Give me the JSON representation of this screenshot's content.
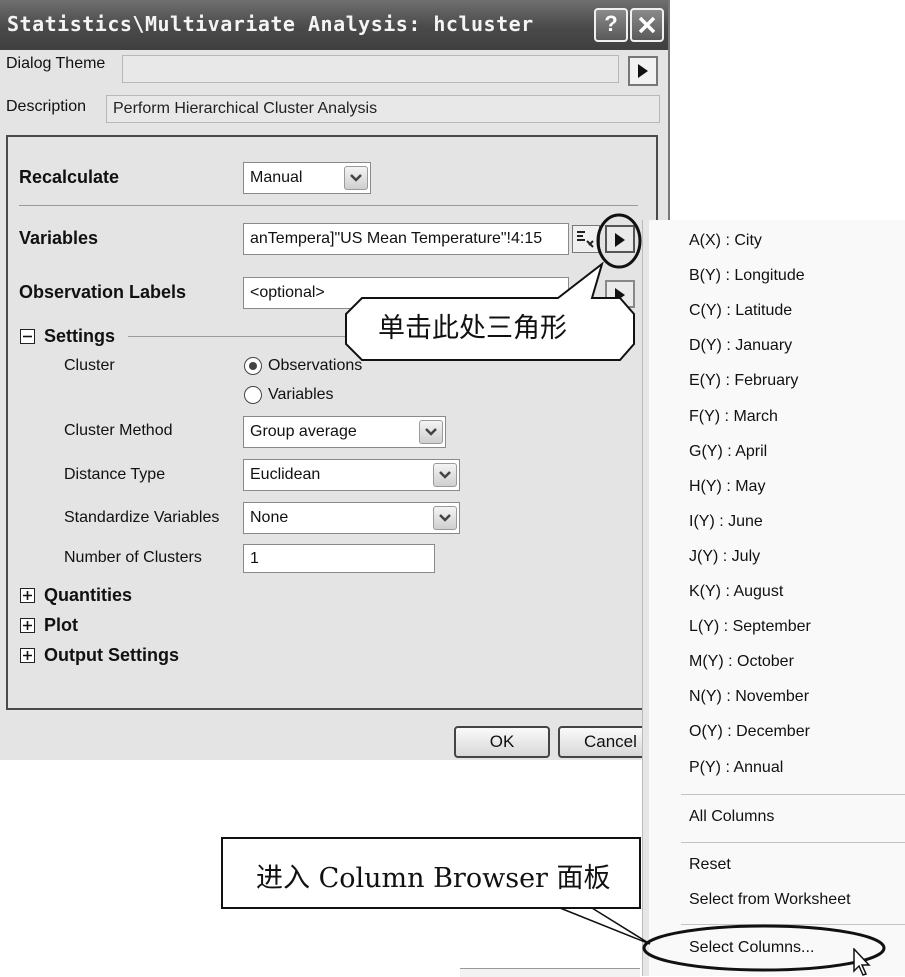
{
  "window": {
    "title": "Statistics\\Multivariate Analysis: hcluster"
  },
  "titlebar": {
    "help_label": "?",
    "close_label": "✕"
  },
  "header": {
    "dialog_theme_label": "Dialog Theme",
    "dialog_theme_value": "",
    "description_label": "Description",
    "description_value": "Perform Hierarchical Cluster Analysis"
  },
  "form": {
    "recalculate_label": "Recalculate",
    "recalculate_value": "Manual",
    "variables_label": "Variables",
    "variables_value": "anTempera]\"US Mean Temperature\"!4:15",
    "obs_labels_label": "Observation Labels",
    "obs_labels_value": "<optional>"
  },
  "settings": {
    "title": "Settings",
    "cluster_label": "Cluster",
    "cluster_options": [
      "Observations",
      "Variables"
    ],
    "cluster_method_label": "Cluster Method",
    "cluster_method_value": "Group average",
    "distance_label": "Distance Type",
    "distance_value": "Euclidean",
    "standardize_label": "Standardize Variables",
    "standardize_value": "None",
    "num_clusters_label": "Number of Clusters",
    "num_clusters_value": "1"
  },
  "sections": [
    "Quantities",
    "Plot",
    "Output Settings"
  ],
  "buttons": {
    "ok": "OK",
    "cancel": "Cancel"
  },
  "menu": {
    "columns": [
      "A(X) : City",
      "B(Y) : Longitude",
      "C(Y) : Latitude",
      "D(Y) : January",
      "E(Y) : February",
      "F(Y) : March",
      "G(Y) : April",
      "H(Y) : May",
      "I(Y) : June",
      "J(Y) : July",
      "K(Y) : August",
      "L(Y) : September",
      "M(Y) : October",
      "N(Y) : November",
      "O(Y) : December",
      "P(Y) : Annual"
    ],
    "all_columns": "All Columns",
    "reset": "Reset",
    "select_from_worksheet": "Select from Worksheet",
    "select_columns": "Select Columns..."
  },
  "callouts": {
    "triangle": "单击此处三角形",
    "column_browser": "进入 Column Browser 面板"
  },
  "icons": {
    "expand": "plus-box-icon",
    "collapse": "minus-box-icon",
    "arrow": "triangle-right-icon",
    "combo": "chevron-down-icon"
  }
}
